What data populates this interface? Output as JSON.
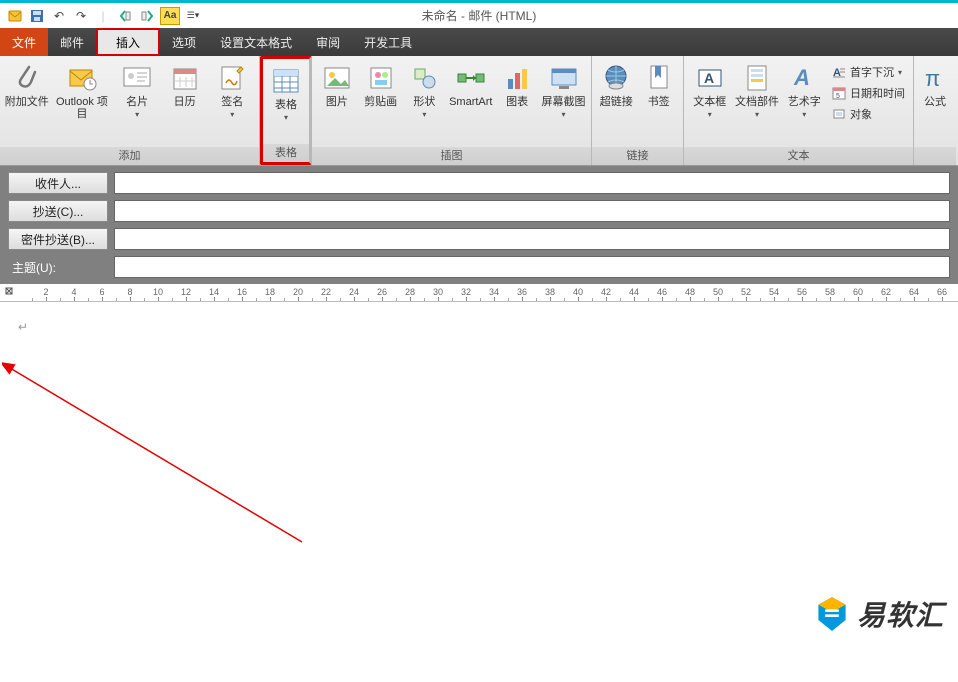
{
  "window": {
    "title": "未命名 - 邮件 (HTML)"
  },
  "qat": {
    "save": "save-icon",
    "undo": "undo-icon",
    "redo": "redo-icon"
  },
  "tabs": {
    "file": "文件",
    "mail": "邮件",
    "insert": "插入",
    "options": "选项",
    "format": "设置文本格式",
    "review": "审阅",
    "devtools": "开发工具"
  },
  "ribbon": {
    "add": {
      "label": "添加",
      "attach": "附加文件",
      "outlook_item": "Outlook 项目",
      "bizcard": "名片",
      "calendar": "日历",
      "signature": "签名"
    },
    "table": {
      "label": "表格",
      "table": "表格"
    },
    "illustrations": {
      "label": "插图",
      "picture": "图片",
      "clipart": "剪贴画",
      "shapes": "形状",
      "smartart": "SmartArt",
      "chart": "图表",
      "screenshot": "屏幕截图"
    },
    "links": {
      "label": "链接",
      "hyperlink": "超链接",
      "bookmark": "书签"
    },
    "text": {
      "label": "文本",
      "textbox": "文本框",
      "docparts": "文档部件",
      "wordart": "艺术字",
      "dropcap": "首字下沉",
      "datetime": "日期和时间",
      "object": "对象"
    },
    "symbols": {
      "label": "",
      "equation": "公式"
    }
  },
  "addr": {
    "to": "收件人...",
    "cc": "抄送(C)...",
    "bcc": "密件抄送(B)...",
    "subject": "主题(U):"
  },
  "ruler": {
    "marks": [
      2,
      4,
      6,
      8,
      10,
      12,
      14,
      16,
      18,
      20,
      22,
      24,
      26,
      28,
      30,
      32,
      34,
      36,
      38,
      40,
      42,
      44,
      46,
      48,
      50,
      52,
      54,
      56,
      58,
      60,
      62,
      64,
      66
    ]
  },
  "body": {
    "cursor": "↵"
  },
  "watermark": {
    "text": "易软汇"
  }
}
